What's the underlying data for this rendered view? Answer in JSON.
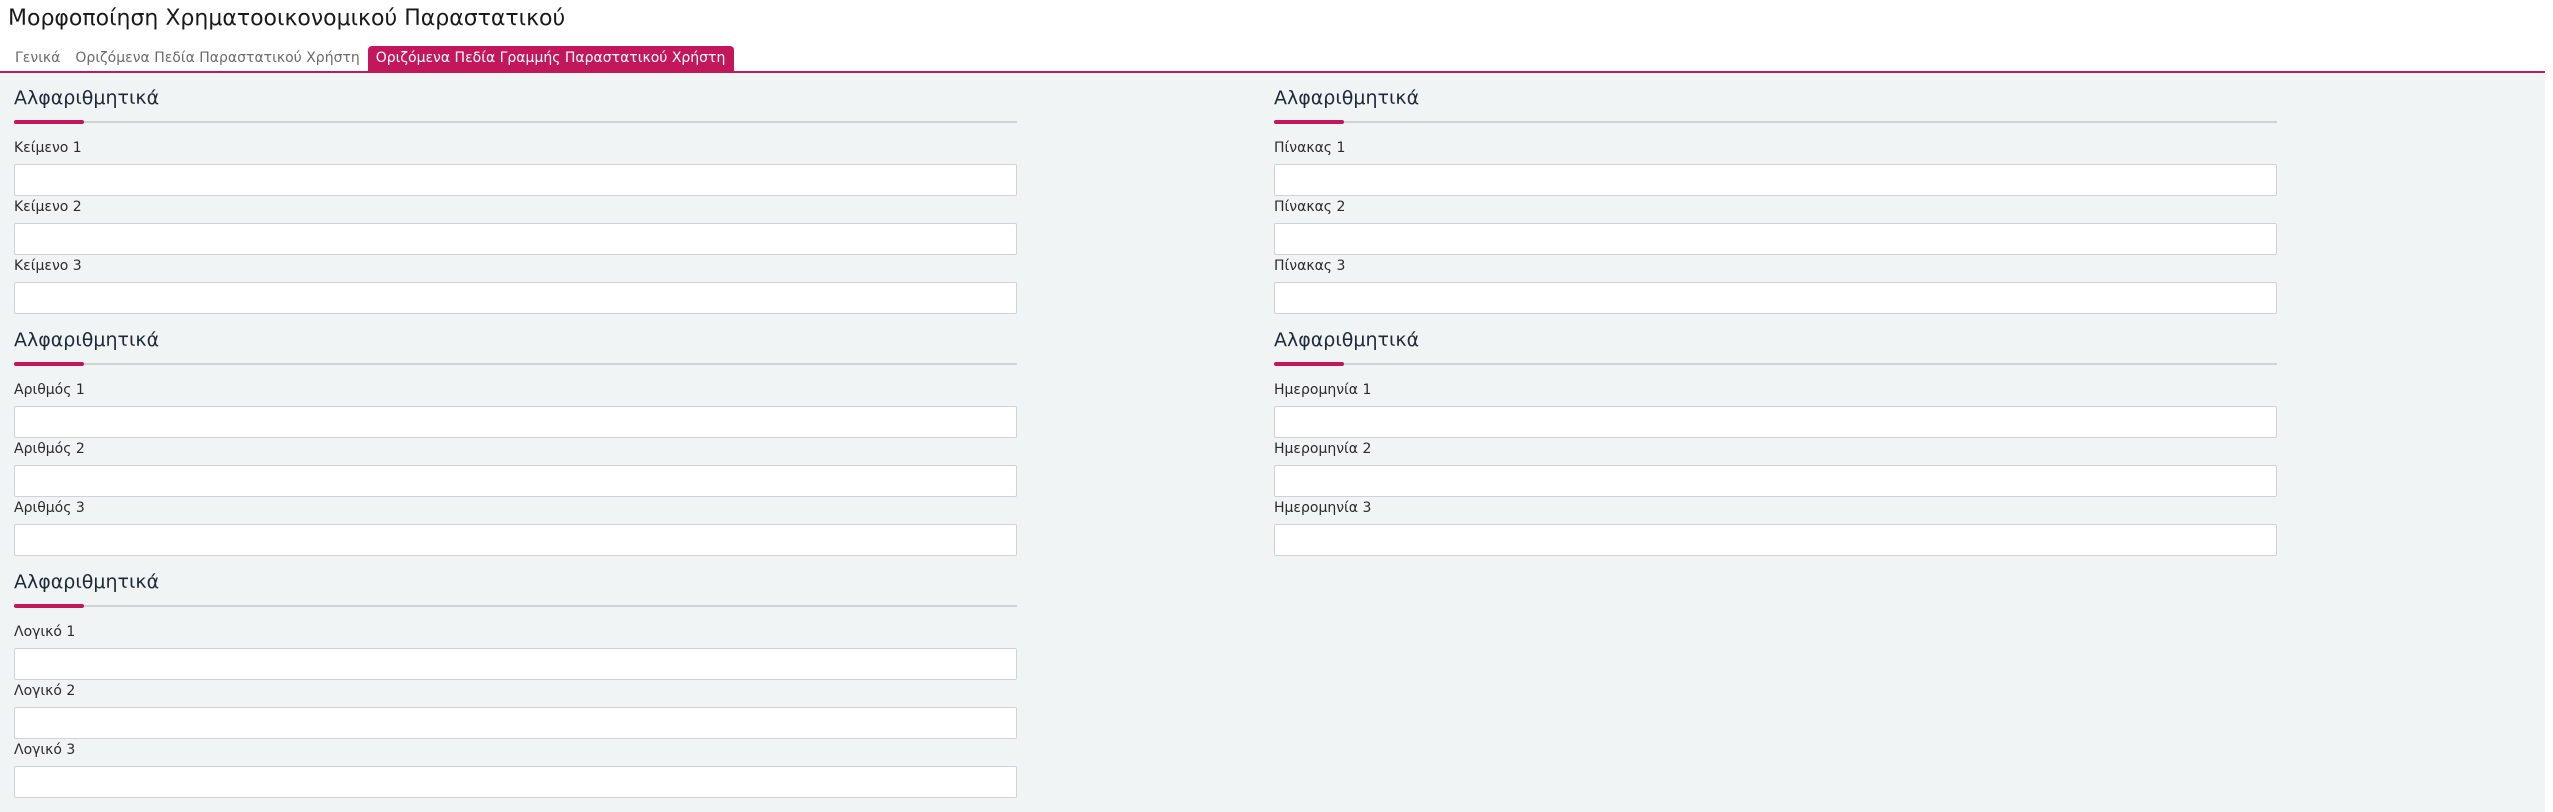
{
  "page": {
    "title": "Μορφοποίηση Χρηματοοικονομικού Παραστατικού"
  },
  "tabs": [
    {
      "label": "Γενικά",
      "active": false
    },
    {
      "label": "Οριζόμενα Πεδία Παραστατικού Χρήστη",
      "active": false
    },
    {
      "label": "Οριζόμενα Πεδία Γραμμής Παραστατικού Χρήστη",
      "active": true
    }
  ],
  "left": [
    {
      "title": "Αλφαριθμητικά",
      "fields": [
        {
          "label": "Κείμενο 1",
          "value": ""
        },
        {
          "label": "Κείμενο 2",
          "value": ""
        },
        {
          "label": "Κείμενο 3",
          "value": ""
        }
      ]
    },
    {
      "title": "Αλφαριθμητικά",
      "fields": [
        {
          "label": "Αριθμός 1",
          "value": ""
        },
        {
          "label": "Αριθμός 2",
          "value": ""
        },
        {
          "label": "Αριθμός 3",
          "value": ""
        }
      ]
    },
    {
      "title": "Αλφαριθμητικά",
      "fields": [
        {
          "label": "Λογικό 1",
          "value": ""
        },
        {
          "label": "Λογικό 2",
          "value": ""
        },
        {
          "label": "Λογικό 3",
          "value": ""
        }
      ]
    }
  ],
  "right": [
    {
      "title": "Αλφαριθμητικά",
      "fields": [
        {
          "label": "Πίνακας 1",
          "value": ""
        },
        {
          "label": "Πίνακας 2",
          "value": ""
        },
        {
          "label": "Πίνακας 3",
          "value": ""
        }
      ]
    },
    {
      "title": "Αλφαριθμητικά",
      "fields": [
        {
          "label": "Ημερομηνία 1",
          "value": ""
        },
        {
          "label": "Ημερομηνία 2",
          "value": ""
        },
        {
          "label": "Ημερομηνία 3",
          "value": ""
        }
      ]
    }
  ],
  "colors": {
    "accent": "#c2185b",
    "panel_bg": "#f1f4f5"
  }
}
